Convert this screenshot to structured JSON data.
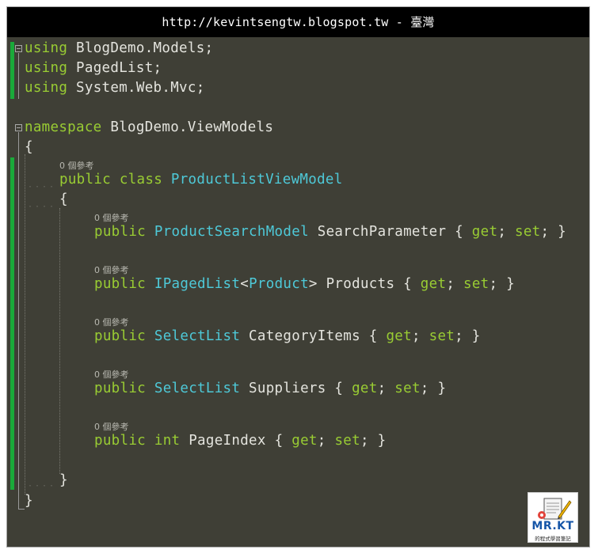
{
  "banner": {
    "text": "http://kevintsengtw.blogspot.tw - 臺灣"
  },
  "code": {
    "lines": {
      "l1": {
        "kw": "using",
        "rest": " BlogDemo.Models;"
      },
      "l2": {
        "kw": "using",
        "rest": " PagedList;"
      },
      "l3": {
        "kw": "using",
        "rest": " System.Web.Mvc;"
      },
      "l5": {
        "kw": "namespace",
        "rest": " BlogDemo.ViewModels"
      },
      "l6": {
        "text": "{"
      },
      "lens_class": "0 個參考",
      "l7": {
        "kw1": "public",
        "kw2": "class",
        "type": "ProductListViewModel"
      },
      "l8": {
        "text": "{"
      },
      "lens_p1": "0 個參考",
      "p1": {
        "kw": "public",
        "type": "ProductSearchModel",
        "name": " SearchParameter { ",
        "get": "get",
        "sep": "; ",
        "set": "set",
        "end": "; }"
      },
      "lens_p2": "0 個參考",
      "p2": {
        "kw": "public",
        "type": "IPagedList",
        "lt": "<",
        "type2": "Product",
        "gt": ">",
        "name": " Products { ",
        "get": "get",
        "sep": "; ",
        "set": "set",
        "end": "; }"
      },
      "lens_p3": "0 個參考",
      "p3": {
        "kw": "public",
        "type": "SelectList",
        "name": " CategoryItems { ",
        "get": "get",
        "sep": "; ",
        "set": "set",
        "end": "; }"
      },
      "lens_p4": "0 個參考",
      "p4": {
        "kw": "public",
        "type": "SelectList",
        "name": " Suppliers { ",
        "get": "get",
        "sep": "; ",
        "set": "set",
        "end": "; }"
      },
      "lens_p5": "0 個參考",
      "p5": {
        "kw": "public",
        "kw2": "int",
        "name": " PageIndex { ",
        "get": "get",
        "sep": "; ",
        "set": "set",
        "end": "; }"
      },
      "l_close_class": {
        "text": "}"
      },
      "l_close_ns": {
        "text": "}"
      }
    }
  },
  "logo": {
    "title": "MR.KT",
    "subtitle": "的程式學習筆記"
  },
  "colors": {
    "background": "#3f3f36",
    "keyword": "#99cc33",
    "type": "#4ec9d8",
    "text": "#e4e4de",
    "change_bar": "#1aaa3a"
  },
  "icons": {
    "collapse": "collapse-minus-icon",
    "logo": "mrkt-logo-icon"
  }
}
